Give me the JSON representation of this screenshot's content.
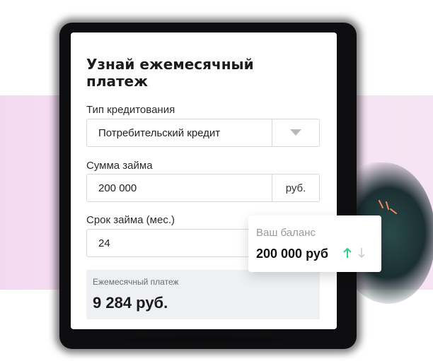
{
  "calculator": {
    "title": "Узнай ежемесячный платеж",
    "credit_type": {
      "label": "Тип кредитования",
      "selected": "Потребительский кредит",
      "dropdown_icon": "triangle-down-icon"
    },
    "loan_amount": {
      "label": "Сумма займа",
      "value": "200 000",
      "unit": "руб."
    },
    "loan_term": {
      "label": "Срок займа (мес.)",
      "value": "24"
    },
    "monthly_payment": {
      "label": "Ежемесячный платеж",
      "value": "9 284 руб."
    }
  },
  "balance_card": {
    "label": "Ваш баланс",
    "value": "200 000 руб",
    "up_icon": "arrow-up-icon",
    "down_icon": "arrow-down-icon"
  },
  "colors": {
    "accent_green": "#2ecc8a",
    "muted_arrow": "#c8c8c8",
    "spark_orange": "#f08a5d",
    "pink_band": "#f4dcf1",
    "result_bg": "#eef0f3"
  }
}
